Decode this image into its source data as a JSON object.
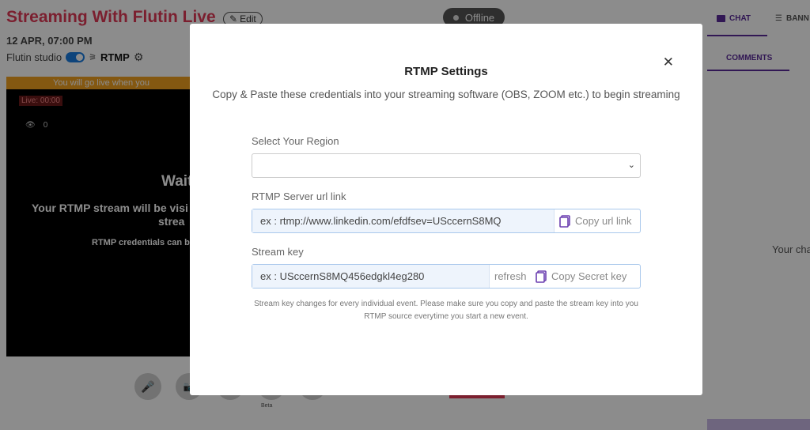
{
  "header": {
    "title": "Streaming With Flutin Live",
    "edit_label": "Edit",
    "status": "Offline",
    "date_time": "12 APR, 07:00 PM",
    "studio_label": "Flutin studio",
    "rtmp_label": "RTMP"
  },
  "video": {
    "banner": "You will go live when you",
    "live_timer": "Live: 00:00",
    "viewer_count": "0",
    "waiting": "Wait",
    "rtmp_msg_1": "Your RTMP stream will be visi",
    "rtmp_msg_2": "strea",
    "cred_msg": "RTMP credentials can b",
    "beta_label": "Beta"
  },
  "right_panel": {
    "tab_chat": "CHAT",
    "tab_banners": "BANN",
    "sub_comments": "COMMENTS",
    "empty_chat": "Your cha"
  },
  "modal": {
    "title": "RTMP Settings",
    "subtitle": "Copy & Paste these credentials into your streaming software (OBS, ZOOM etc.) to begin streaming",
    "region_label": "Select Your Region",
    "region_value": "",
    "server_label": "RTMP Server url link",
    "server_value": "ex : rtmp://www.linkedin.com/efdfsev=USccernS8MQ",
    "copy_url": "Copy url link",
    "key_label": "Stream key",
    "key_value": "ex : USccernS8MQ456edgkl4eg280",
    "refresh": "refresh",
    "copy_key": "Copy Secret key",
    "note": "Stream key changes for every individual event. Please make sure you copy and paste the stream key into you RTMP source everytime you start a new event."
  },
  "colors": {
    "brand_red": "#e03a57",
    "brand_purple": "#5a2a9a",
    "toggle_blue": "#1b7de0",
    "banner_orange": "#f0a020"
  }
}
